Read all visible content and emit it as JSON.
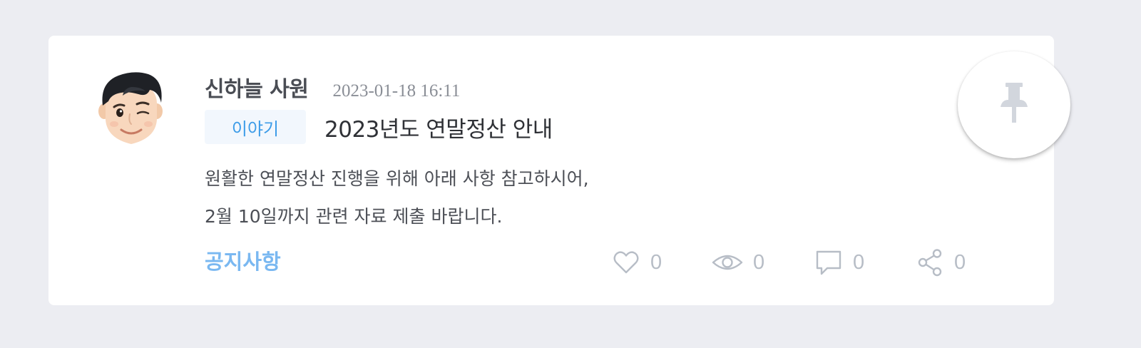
{
  "post": {
    "author": "신하늘 사원",
    "date": "2023-01-18 16:11",
    "tag": "이야기",
    "title": "2023년도 연말정산 안내",
    "body_lines": [
      "원활한 연말정산 진행을 위해 아래 사항 참고하시어,",
      "2월 10일까지 관련 자료 제출 바랍니다."
    ],
    "category": "공지사항"
  },
  "stats": {
    "likes": "0",
    "views": "0",
    "comments": "0",
    "shares": "0"
  },
  "icons": {
    "like": "heart-icon",
    "views": "eye-icon",
    "comments": "comment-icon",
    "share": "share-icon",
    "pin": "pin-icon"
  },
  "colors": {
    "background": "#ecedf2",
    "tag_text": "#3d9ce8",
    "tag_bg": "#f2f7fd",
    "category": "#7ab8f1",
    "stat": "#b7bdc6",
    "pin": "#d2d6dd"
  }
}
